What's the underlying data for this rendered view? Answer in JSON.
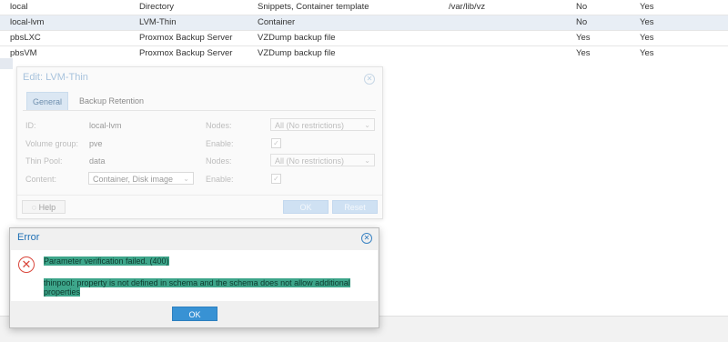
{
  "storage_grid": {
    "rows": [
      {
        "id": "local",
        "type": "Directory",
        "content": "Snippets, Container template",
        "path": "/var/lib/vz",
        "shared": "No",
        "enabled": "Yes"
      },
      {
        "id": "local-lvm",
        "type": "LVM-Thin",
        "content": "Container",
        "path": "",
        "shared": "No",
        "enabled": "Yes"
      },
      {
        "id": "pbsLXC",
        "type": "Proxmox Backup Server",
        "content": "VZDump backup file",
        "path": "",
        "shared": "Yes",
        "enabled": "Yes"
      },
      {
        "id": "pbsVM",
        "type": "Proxmox Backup Server",
        "content": "VZDump backup file",
        "path": "",
        "shared": "Yes",
        "enabled": "Yes"
      }
    ]
  },
  "edit_window": {
    "title": "Edit: LVM-Thin",
    "tabs": [
      "General",
      "Backup Retention"
    ],
    "fields": {
      "id_label": "ID:",
      "id_value": "local-lvm",
      "vg_label": "Volume group:",
      "vg_value": "pve",
      "thinpool_label": "Thin Pool:",
      "thinpool_value": "data",
      "content_label": "Content:",
      "content_value": "Container, Disk image",
      "nodes_label": "Nodes:",
      "nodes_value": "All (No restrictions)",
      "enable_label": "Enable:"
    },
    "buttons": {
      "help": "Help",
      "ok": "OK",
      "reset": "Reset"
    }
  },
  "error_dialog": {
    "title": "Error",
    "message_line1": "Parameter verification failed. (400)",
    "message_line2": "thinpool: property is not defined in schema and the schema does not allow additional",
    "message_line3": "properties",
    "ok_label": "OK"
  },
  "colors": {
    "accent": "#3892d4",
    "error_icon": "#d9463b",
    "highlight": "#3da58a"
  }
}
